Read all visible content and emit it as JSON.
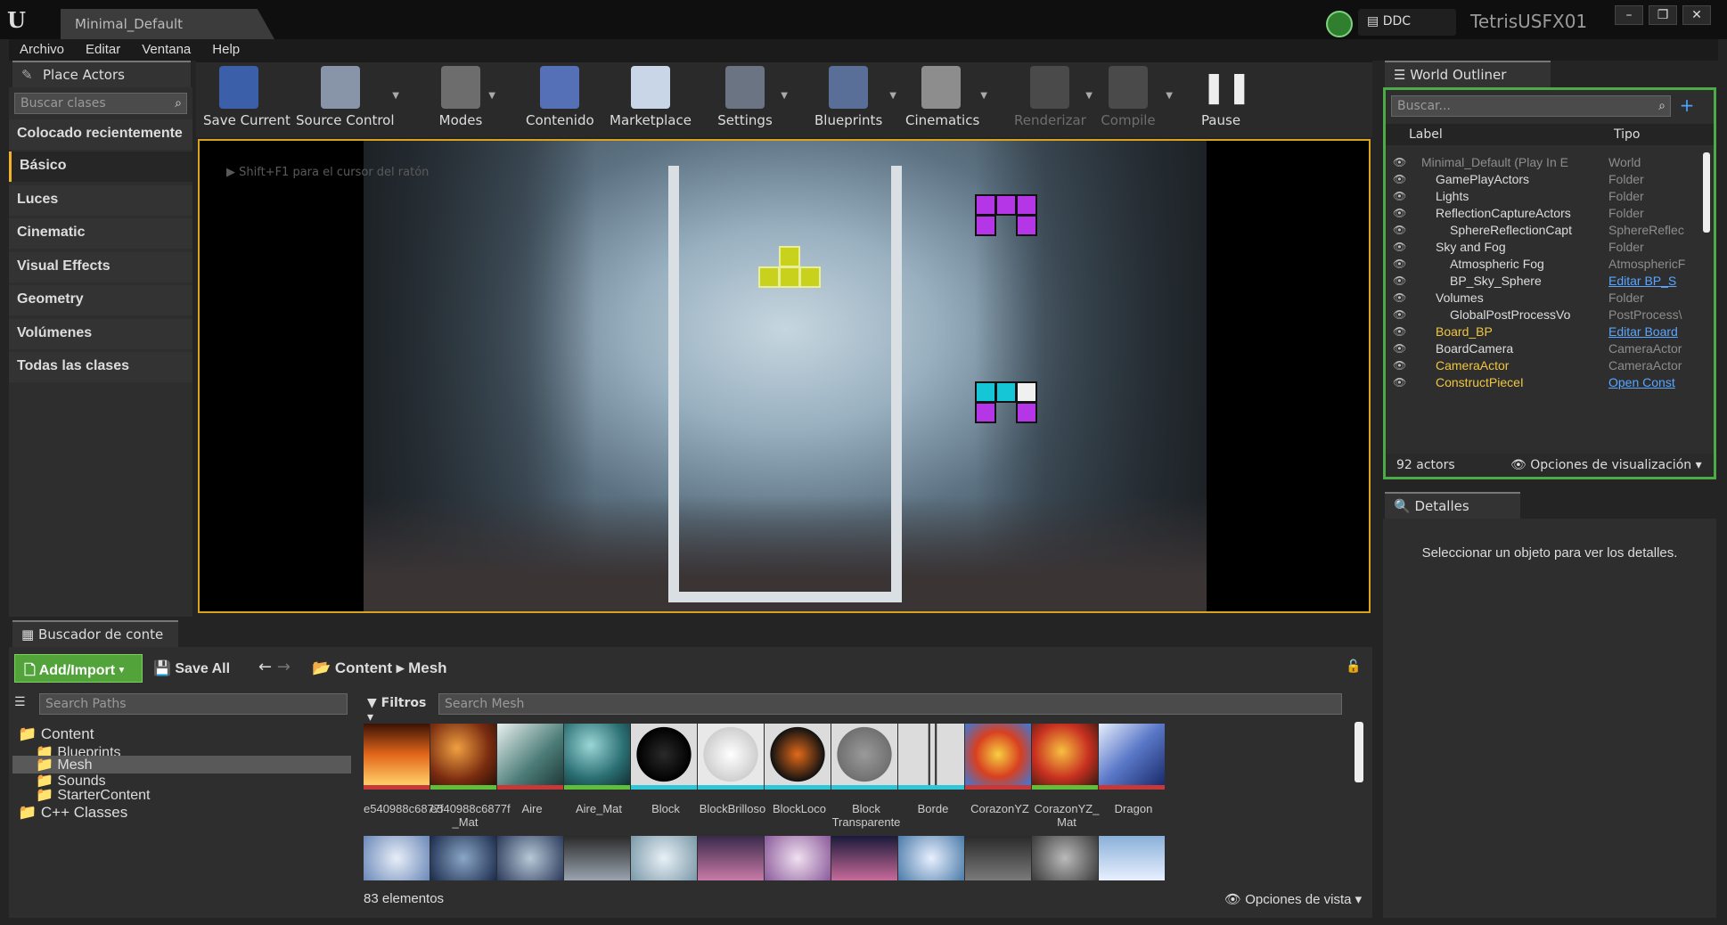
{
  "titlebar": {
    "doc_tab": "Minimal_Default",
    "ddc": "DDC",
    "project": "TetrisUSFX01",
    "win_min": "–",
    "win_max": "❐",
    "win_close": "✕"
  },
  "menu": [
    "Archivo",
    "Editar",
    "Ventana",
    "Help"
  ],
  "place_actors": {
    "tab": "Place Actors",
    "search_placeholder": "Buscar clases",
    "categories": [
      "Colocado recientemente",
      "Básico",
      "Luces",
      "Cinematic",
      "Visual Effects",
      "Geometry",
      "Volúmenes",
      "Todas las clases"
    ],
    "selected": "Básico"
  },
  "toolbar": {
    "items": [
      "Save Current",
      "Source Control",
      "Modes",
      "Contenido",
      "Marketplace",
      "Settings",
      "Blueprints",
      "Cinematics",
      "Renderizar",
      "Compile",
      "Pause"
    ],
    "disabled": [
      "Renderizar",
      "Compile"
    ],
    "more": "»"
  },
  "viewport": {
    "hint": "▶  Shift+F1 para el cursor del ratón"
  },
  "world_outliner": {
    "tab": "World Outliner",
    "search_placeholder": "Buscar...",
    "col_label": "Label",
    "col_type": "Tipo",
    "rows": [
      {
        "label": "Minimal_Default (Play In E",
        "type": "World",
        "indent": 0,
        "style": "gr"
      },
      {
        "label": "GamePlayActors",
        "type": "Folder",
        "indent": 1
      },
      {
        "label": "Lights",
        "type": "Folder",
        "indent": 1
      },
      {
        "label": "ReflectionCaptureActors",
        "type": "Folder",
        "indent": 1
      },
      {
        "label": "SphereReflectionCapt",
        "type": "SphereReflec",
        "indent": 2
      },
      {
        "label": "Sky and Fog",
        "type": "Folder",
        "indent": 1
      },
      {
        "label": "Atmospheric Fog",
        "type": "AtmosphericF",
        "indent": 2
      },
      {
        "label": "BP_Sky_Sphere",
        "type": "Editar BP_S",
        "indent": 2,
        "link": true
      },
      {
        "label": "Volumes",
        "type": "Folder",
        "indent": 1
      },
      {
        "label": "GlobalPostProcessVo",
        "type": "PostProcess\\",
        "indent": 2
      },
      {
        "label": "Board_BP",
        "type": "Editar Board",
        "indent": 1,
        "style": "yl",
        "link": true
      },
      {
        "label": "BoardCamera",
        "type": "CameraActor",
        "indent": 1
      },
      {
        "label": "CameraActor",
        "type": "CameraActor",
        "indent": 1,
        "style": "yl"
      },
      {
        "label": "ConstructPieceI",
        "type": "Open Const",
        "indent": 1,
        "style": "yl",
        "link": true
      }
    ],
    "count": "92 actors",
    "view_options": "Opciones de visualización"
  },
  "details": {
    "tab": "Detalles",
    "message": "Seleccionar un objeto para ver los detalles."
  },
  "content_browser": {
    "tab": "Buscador de conte",
    "add_import": "Add/Import",
    "save_all": "Save All",
    "breadcrumb": [
      "Content",
      "Mesh"
    ],
    "path_search_placeholder": "Search Paths",
    "filters": "Filtros",
    "mesh_search_placeholder": "Search Mesh",
    "tree": [
      {
        "label": "Content",
        "indent": 0,
        "big": true
      },
      {
        "label": "Blueprints",
        "indent": 1
      },
      {
        "label": "Mesh",
        "indent": 1,
        "selected": true
      },
      {
        "label": "Sounds",
        "indent": 1
      },
      {
        "label": "StarterContent",
        "indent": 1
      },
      {
        "label": "C++ Classes",
        "indent": 0,
        "big": true
      }
    ],
    "assets": [
      "e540988c6877f",
      "e540988c6877f _Mat",
      "Aire",
      "Aire_Mat",
      "Block",
      "BlockBrilloso",
      "BlockLoco",
      "Block Transparente",
      "Borde",
      "CorazonYZ",
      "CorazonYZ_ Mat",
      "Dragon"
    ],
    "count": "83 elementos",
    "view_options": "Opciones de vista"
  },
  "colors": {
    "accent": "#d9a21f",
    "outliner_border": "#4caa47",
    "add_import": "#53a33b",
    "link": "#5aa6ff",
    "actor_yellow": "#f0c640",
    "purple_block": "#b436e6",
    "yellow_block": "#c8d21c",
    "cyan_block": "#15c6d6"
  }
}
